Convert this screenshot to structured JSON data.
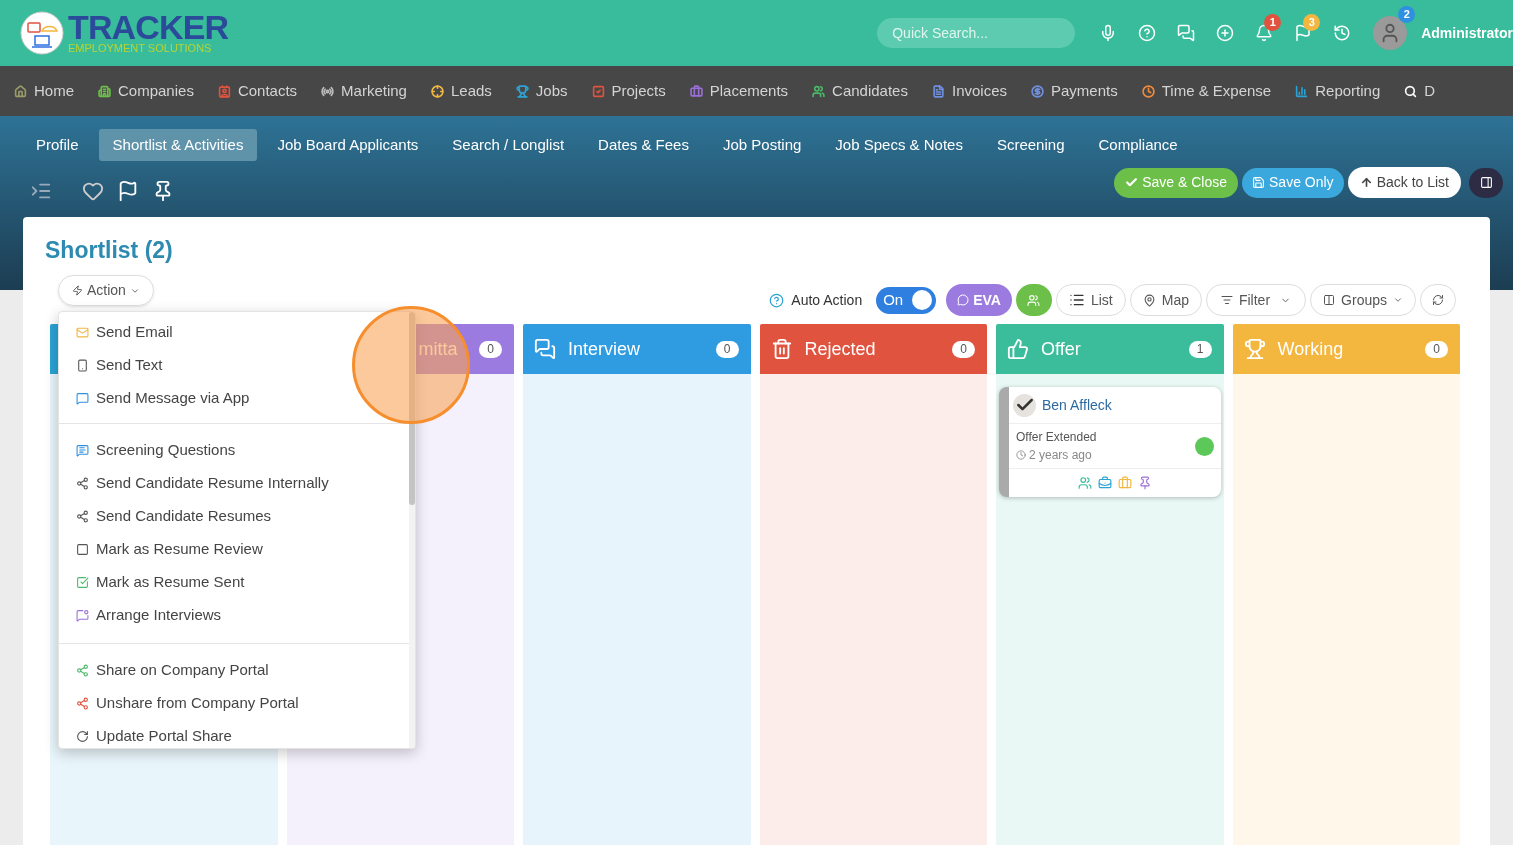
{
  "brand": {
    "name": "TRACKER",
    "tagline": "EMPLOYMENT SOLUTIONS"
  },
  "top_bar": {
    "search": {
      "placeholder": "Quick Search..."
    },
    "notifications": "1",
    "flags": "3",
    "user": {
      "badge": "2",
      "name": "Administrator"
    }
  },
  "nav": [
    {
      "label": "Home",
      "color": "#9a9a6a"
    },
    {
      "label": "Companies",
      "color": "#6cc04a"
    },
    {
      "label": "Contacts",
      "color": "#e0533f"
    },
    {
      "label": "Marketing",
      "color": "#bbbbbb"
    },
    {
      "label": "Leads",
      "color": "#f3b63f"
    },
    {
      "label": "Jobs",
      "color": "#2aa3d5"
    },
    {
      "label": "Projects",
      "color": "#e0533f"
    },
    {
      "label": "Placements",
      "color": "#9b6fd9"
    },
    {
      "label": "Candidates",
      "color": "#4cb86a"
    },
    {
      "label": "Invoices",
      "color": "#6f8fe0"
    },
    {
      "label": "Payments",
      "color": "#6f8fe0"
    },
    {
      "label": "Time & Expense",
      "color": "#f08a3c"
    },
    {
      "label": "Reporting",
      "color": "#2aa3d5"
    },
    {
      "label": "D",
      "color": "#ffffff"
    }
  ],
  "tabs": [
    {
      "label": "Profile",
      "selected": false
    },
    {
      "label": "Shortlist & Activities",
      "selected": true
    },
    {
      "label": "Job Board Applicants",
      "selected": false
    },
    {
      "label": "Search / Longlist",
      "selected": false
    },
    {
      "label": "Dates & Fees",
      "selected": false
    },
    {
      "label": "Job Posting",
      "selected": false
    },
    {
      "label": "Job Specs & Notes",
      "selected": false
    },
    {
      "label": "Screening",
      "selected": false
    },
    {
      "label": "Compliance",
      "selected": false
    }
  ],
  "actions": {
    "save_close": "Save & Close",
    "save_only": "Save Only",
    "back": "Back to List"
  },
  "shortlist": {
    "title": "Shortlist (2)",
    "action_button": "Action",
    "auto_action": {
      "label": "Auto Action",
      "toggle": "On",
      "on": true
    },
    "eva": "EVA",
    "list": "List",
    "map": "Map",
    "filter": "Filter",
    "groups": "Groups",
    "menu": [
      [
        "Send Email",
        "Send Text",
        "Send Message via App"
      ],
      [
        "Screening Questions",
        "Send Candidate Resume Internally",
        "Send Candidate Resumes",
        "Mark as Resume Review",
        "Mark as Resume Sent",
        "Arrange Interviews"
      ],
      [
        "Share on Company Portal",
        "Unshare from Company Portal",
        "Update Portal Share"
      ]
    ],
    "columns": [
      {
        "kind": "hidden",
        "color": "#2aa3d5"
      },
      {
        "kind": "partial",
        "title": "mitta",
        "count": "0",
        "color": "#9b7be0"
      },
      {
        "kind": "full",
        "title": "Interview",
        "count": "0",
        "color": "#2f9be0"
      },
      {
        "kind": "full",
        "title": "Rejected",
        "count": "0",
        "color": "#e0533f"
      },
      {
        "kind": "full",
        "title": "Offer",
        "count": "1",
        "color": "#3bbd9c",
        "cards": [
          {
            "name": "Ben Affleck",
            "status": "Offer Extended",
            "time": "2 years ago",
            "color": "#5cc85a"
          }
        ]
      },
      {
        "kind": "full",
        "title": "Working",
        "count": "0",
        "color": "#f3b63f"
      }
    ]
  }
}
